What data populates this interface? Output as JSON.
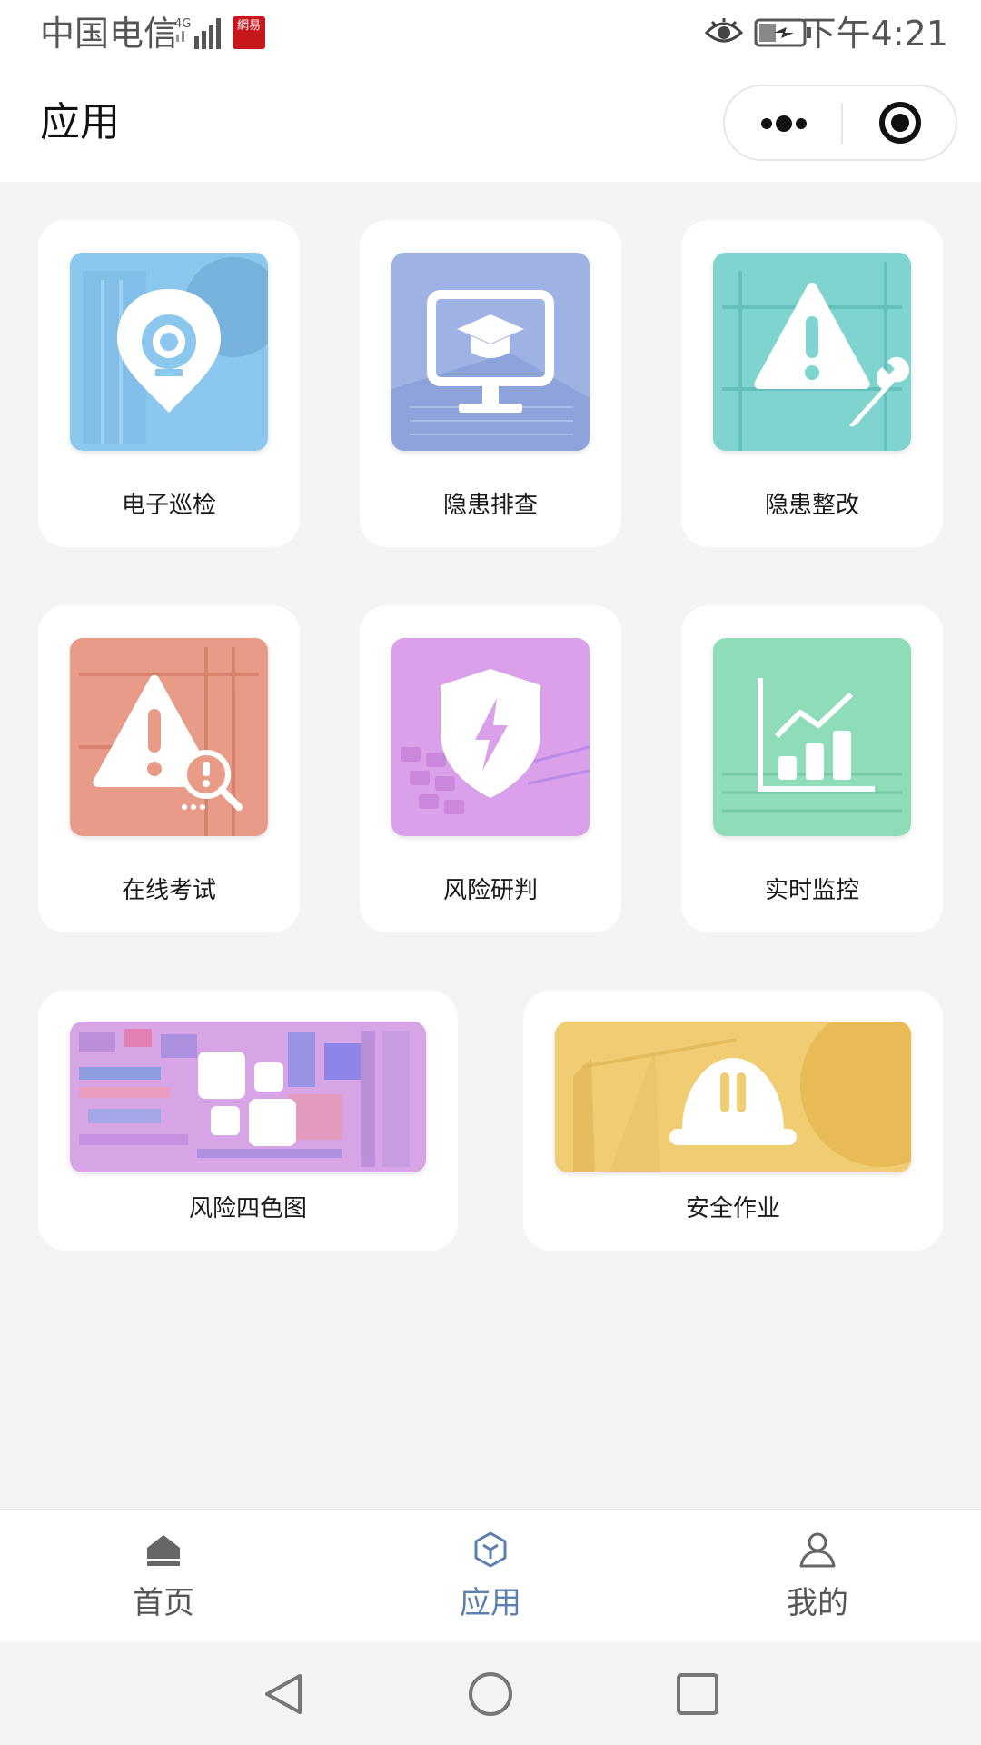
{
  "status_bar": {
    "carrier": "中国电信",
    "network": "4G",
    "app_badge": "網易",
    "time": "下午4:21"
  },
  "nav": {
    "title": "应用"
  },
  "apps": [
    {
      "label": "电子巡检",
      "icon": "location-camera-icon",
      "color": "#8cc8ee"
    },
    {
      "label": "隐患排查",
      "icon": "monitor-graduation-icon",
      "color": "#9fb2e4"
    },
    {
      "label": "隐患整改",
      "icon": "warning-wrench-icon",
      "color": "#7fd4cf"
    },
    {
      "label": "在线考试",
      "icon": "warning-search-icon",
      "color": "#e89b86"
    },
    {
      "label": "风险研判",
      "icon": "shield-bolt-icon",
      "color": "#dba0ea"
    },
    {
      "label": "实时监控",
      "icon": "bar-line-chart-icon",
      "color": "#8edcb8"
    },
    {
      "label": "风险四色图",
      "icon": "map-grid-icon",
      "color": "#d7a5e6"
    },
    {
      "label": "安全作业",
      "icon": "safety-helmet-icon",
      "color": "#f0cd72"
    }
  ],
  "tabs": [
    {
      "label": "首页",
      "icon": "home-icon",
      "active": false
    },
    {
      "label": "应用",
      "icon": "cube-icon",
      "active": true
    },
    {
      "label": "我的",
      "icon": "user-icon",
      "active": false
    }
  ],
  "colors": {
    "tab_active": "#5b7fae",
    "tab_inactive": "#555555",
    "background": "#f4f4f4"
  }
}
